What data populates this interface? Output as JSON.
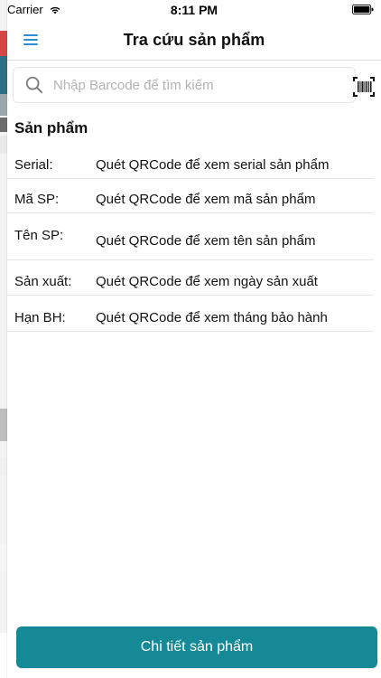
{
  "status_bar": {
    "carrier": "Carrier",
    "time": "8:11 PM"
  },
  "nav": {
    "title": "Tra cứu sản phẩm"
  },
  "search": {
    "placeholder": "Nhập Barcode để tìm kiếm"
  },
  "section": {
    "title": "Sản phẩm",
    "rows": [
      {
        "key": "Serial:",
        "value": "Quét QRCode để xem serial sản phẩm"
      },
      {
        "key": "Mã SP:",
        "value": "Quét QRCode để xem mã sản phẩm"
      },
      {
        "key": "Tên SP:",
        "value": "Quét QRCode để xem tên sản phẩm"
      },
      {
        "key": "Sản xuất:",
        "value": "Quét QRCode để xem ngày sản xuất"
      },
      {
        "key": "Hạn BH:",
        "value": "Quét QRCode để xem tháng bảo hành"
      }
    ]
  },
  "actions": {
    "details_label": "Chi tiết sản phẩm"
  },
  "icons": {
    "menu": "hamburger-icon",
    "search": "search-icon",
    "barcode": "barcode-scan-icon",
    "wifi": "wifi-icon",
    "battery": "battery-icon"
  },
  "colors": {
    "accent": "#2b8fd8",
    "button_bg": "#168996",
    "divider": "#e6e6e6",
    "placeholder": "#b3b3b3"
  }
}
